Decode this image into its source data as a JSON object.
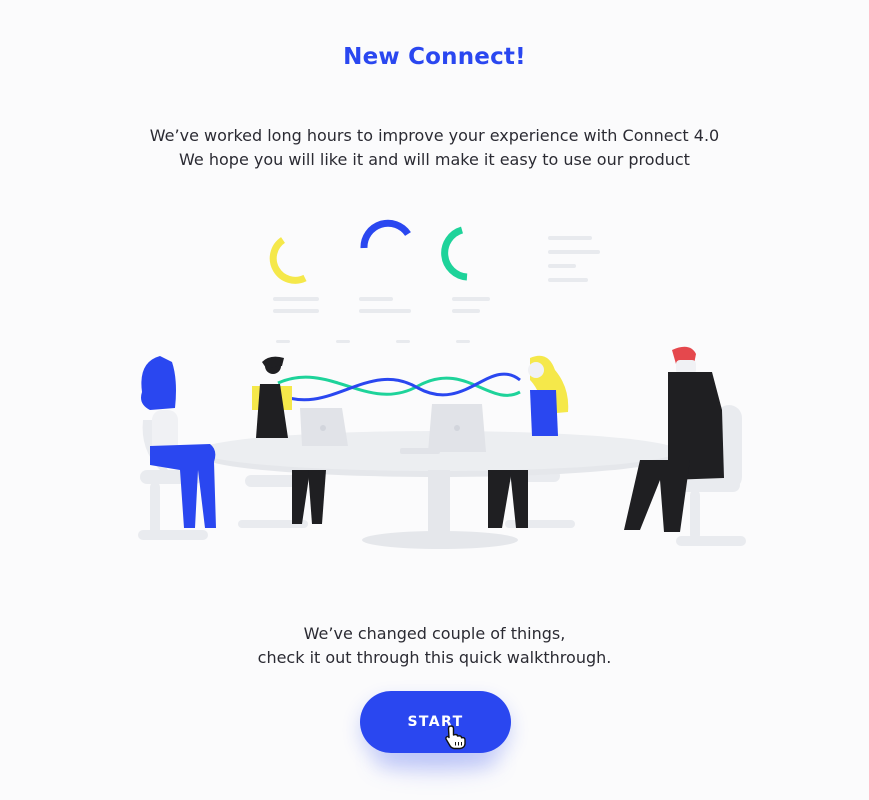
{
  "header": {
    "title": "New Connect!"
  },
  "intro": {
    "line1": "We’ve worked long hours to improve your experience with Connect 4.0",
    "line2": "We hope you will like it and will make it easy to use our product"
  },
  "outro": {
    "line1": "We’ve changed couple of things,",
    "line2": "check it out through this quick walkthrough."
  },
  "start_button": {
    "label": "START"
  },
  "colors": {
    "accent": "#2a47f0",
    "yellow": "#f5e84a",
    "teal": "#1ed39a",
    "red": "#e5484d",
    "dark": "#1f1f22",
    "furniture": "#e9ebef"
  },
  "icons": {
    "cursor": "hand-pointer-icon"
  }
}
